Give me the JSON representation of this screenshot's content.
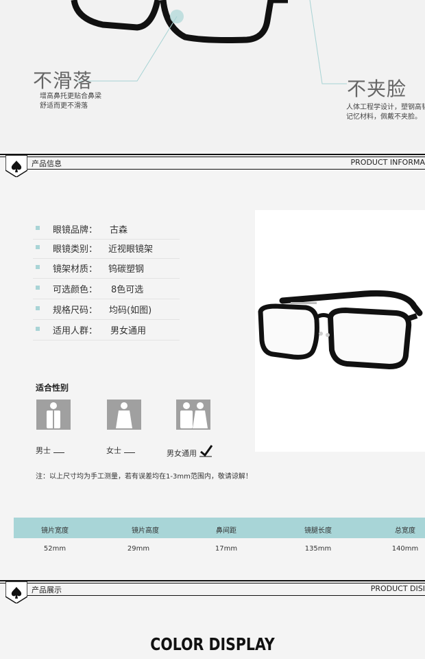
{
  "features": {
    "left": {
      "title": "不滑落",
      "lines": [
        "增高鼻托更贴合鼻梁",
        "舒适而更不滑落"
      ]
    },
    "right": {
      "title": "不夹脸",
      "lines": [
        "人体工程学设计，塑钢高韧",
        "记忆材料，佩戴不夹脸。"
      ]
    }
  },
  "section_info": {
    "title_cn": "产品信息",
    "title_en": "PRODUCT INFORMA"
  },
  "specs": [
    {
      "label": "眼镜品牌：",
      "value": "古森"
    },
    {
      "label": "眼镜类别：",
      "value": "近视眼镜架"
    },
    {
      "label": "镜架材质：",
      "value": "钨碳塑钢"
    },
    {
      "label": "可选颜色：",
      "value": "8色可选"
    },
    {
      "label": "规格尺码：",
      "value": "均码(如图)"
    },
    {
      "label": "适用人群：",
      "value": "男女通用"
    }
  ],
  "gender": {
    "title": "适合性别",
    "options": [
      {
        "label": "男士",
        "icon": "male-icon",
        "checked": false
      },
      {
        "label": "女士",
        "icon": "female-icon",
        "checked": false
      },
      {
        "label": "男女通用",
        "icon": "unisex-icon",
        "checked": true
      }
    ]
  },
  "note": "注：以上尺寸均为手工测量，若有误差均在1-3mm范围内，敬请谅解！",
  "sizes": {
    "headers": [
      "镜片宽度",
      "镜片高度",
      "鼻间距",
      "镜腿长度",
      "总宽度"
    ],
    "values": [
      "52mm",
      "29mm",
      "17mm",
      "135mm",
      "140mm"
    ]
  },
  "section_display": {
    "title_cn": "产品展示",
    "title_en": "PRODUCT DISI"
  },
  "color_display": "COLOR DISPLAY",
  "colors": {
    "accent": "#a8d5d7",
    "icon_gray": "#a0a0a0",
    "frame": "#111111"
  }
}
